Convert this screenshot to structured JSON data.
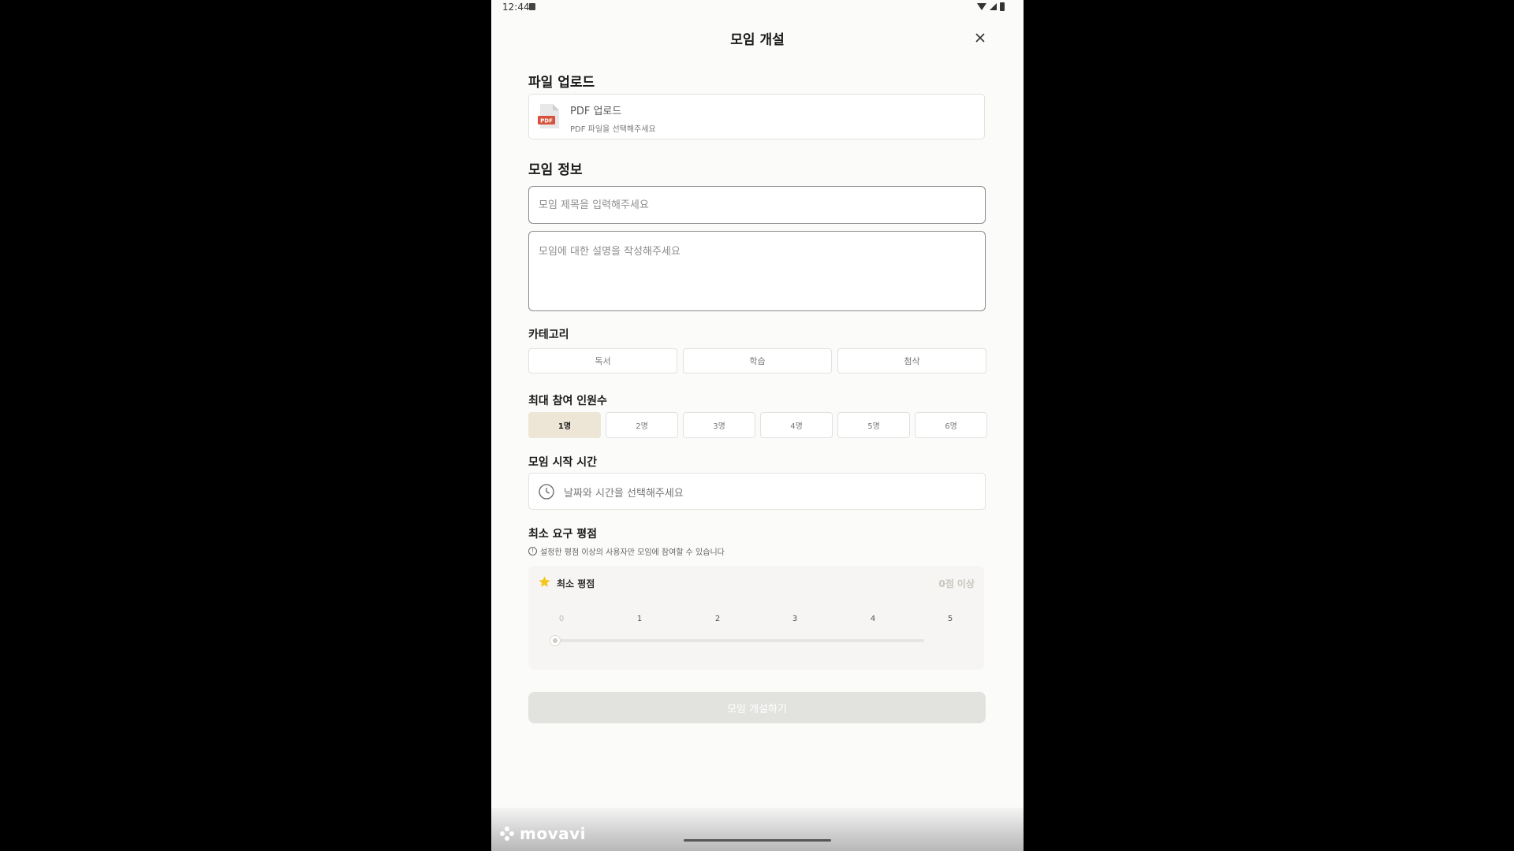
{
  "status_bar": {
    "time": "12:44"
  },
  "header": {
    "title": "모임 개설"
  },
  "upload_section": {
    "title": "파일 업로드",
    "pdf_badge": "PDF",
    "box_title": "PDF 업로드",
    "box_subtitle": "PDF 파일을 선택해주세요"
  },
  "info_section": {
    "title": "모임 정보",
    "title_placeholder": "모임 제목을 입력해주세요",
    "desc_placeholder": "모임에 대한 설명을 작성해주세요"
  },
  "category": {
    "label": "카테고리",
    "options": [
      "독서",
      "학습",
      "첨삭"
    ]
  },
  "max_members": {
    "label": "최대 참여 인원수",
    "options": [
      "1명",
      "2명",
      "3명",
      "4명",
      "5명",
      "6명"
    ],
    "selected": "1명"
  },
  "start_time": {
    "label": "모임 시작 시간",
    "placeholder": "날짜와 시간을 선택해주세요"
  },
  "rating": {
    "label": "최소 요구 평점",
    "info": "설정한 평점 이상의 사용자만 모임에 참여할 수 있습니다",
    "card_label": "최소 평점",
    "value_text": "0점 이상",
    "ticks": [
      "0",
      "1",
      "2",
      "3",
      "4",
      "5"
    ],
    "value": 0,
    "star_color": "#f5c518"
  },
  "submit": {
    "label": "모임 개설하기"
  },
  "watermark": {
    "text": "movavi"
  }
}
